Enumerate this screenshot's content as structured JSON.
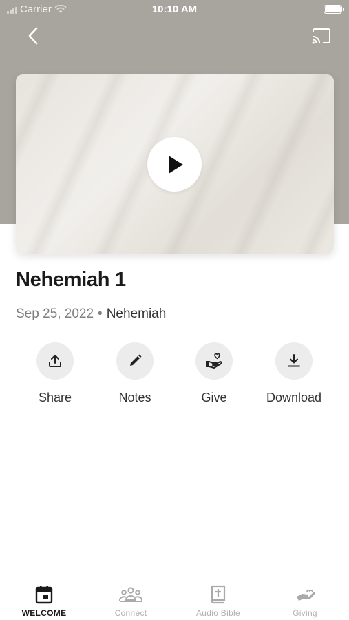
{
  "status_bar": {
    "carrier": "Carrier",
    "time": "10:10 AM"
  },
  "nav": {
    "back_icon": "chevron-left-icon",
    "cast_icon": "cast-icon"
  },
  "video": {
    "play_icon": "play-icon"
  },
  "sermon": {
    "title": "Nehemiah 1",
    "date": "Sep 25, 2022",
    "separator": "•",
    "series": "Nehemiah"
  },
  "actions": [
    {
      "label": "Share",
      "icon": "share-upload-icon"
    },
    {
      "label": "Notes",
      "icon": "pencil-icon"
    },
    {
      "label": "Give",
      "icon": "heart-hand-icon"
    },
    {
      "label": "Download",
      "icon": "download-icon"
    }
  ],
  "tabs": [
    {
      "label": "WELCOME",
      "icon": "calendar-icon",
      "active": true
    },
    {
      "label": "Connect",
      "icon": "people-icon",
      "active": false
    },
    {
      "label": "Audio Bible",
      "icon": "bible-icon",
      "active": false
    },
    {
      "label": "Giving",
      "icon": "giving-hand-icon",
      "active": false
    }
  ],
  "colors": {
    "hero_background": "#a8a59f",
    "action_circle": "#ececec",
    "tab_inactive": "#b0b0b0",
    "tab_active": "#1a1a1a"
  }
}
